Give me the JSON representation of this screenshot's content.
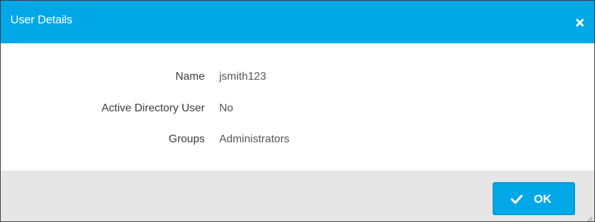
{
  "dialog": {
    "title": "User Details",
    "close_icon": "close-icon"
  },
  "details": {
    "name": {
      "label": "Name",
      "value": "jsmith123"
    },
    "active_directory_user": {
      "label": "Active Directory User",
      "value": "No"
    },
    "groups": {
      "label": "Groups",
      "value": "Administrators"
    }
  },
  "footer": {
    "ok_label": "OK",
    "ok_icon": "checkmark-icon",
    "resize_icon": "resize-grip-icon"
  },
  "colors": {
    "titlebar": "#00a8e8",
    "button": "#00a8e8",
    "footer": "#e6e6e6"
  }
}
